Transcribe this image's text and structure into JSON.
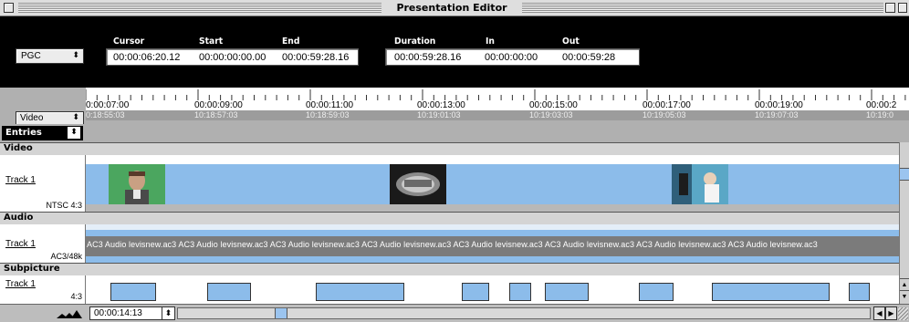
{
  "window": {
    "title": "Presentation Editor"
  },
  "header": {
    "pgc_select": "PGC",
    "labels": {
      "cursor": "Cursor",
      "start": "Start",
      "end": "End",
      "duration": "Duration",
      "in": "In",
      "out": "Out"
    },
    "values": {
      "cursor": "00:00:06:20.12",
      "start": "00:00:00:00.00",
      "end": "00:00:59:28.16",
      "duration": "00:00:59:28.16",
      "in": "00:00:00:00",
      "out": "00:00:59:28"
    }
  },
  "ruler": {
    "timecodes": [
      "0:00:07:00",
      "00:00:09:00",
      "00:00:11:00",
      "00:00:13:00",
      "00:00:15:00",
      "00:00:17:00",
      "00:00:19:00",
      "00:00:2"
    ],
    "alt_timecodes": [
      "0:18:55:03",
      "10:18:57:03",
      "10:18:59:03",
      "10:19:01:03",
      "10:19:03:03",
      "10:19:05:03",
      "10:19:07:03",
      "10:19:0"
    ]
  },
  "view_select": "Video",
  "entries": {
    "label": "Entries"
  },
  "sections": {
    "video": {
      "name": "Video",
      "track": "Track 1",
      "format": "NTSC 4:3"
    },
    "audio": {
      "name": "Audio",
      "track": "Track 1",
      "format": "AC3/48k",
      "clip_text": "AC3 Audio levisnew.ac3 AC3 Audio levisnew.ac3 AC3 Audio levisnew.ac3 AC3 Audio levisnew.ac3 AC3 Audio levisnew.ac3 AC3 Audio levisnew.ac3 AC3 Audio levisnew.ac3 AC3 Audio levisnew.ac3"
    },
    "subpicture": {
      "name": "Subpicture",
      "track": "Track 1",
      "format": "4:3"
    }
  },
  "bottom": {
    "timecode": "00:00:14:13"
  },
  "colors": {
    "clip_blue": "#8cbcea",
    "audio_gray": "#7b7b7b",
    "header_black": "#000000"
  }
}
